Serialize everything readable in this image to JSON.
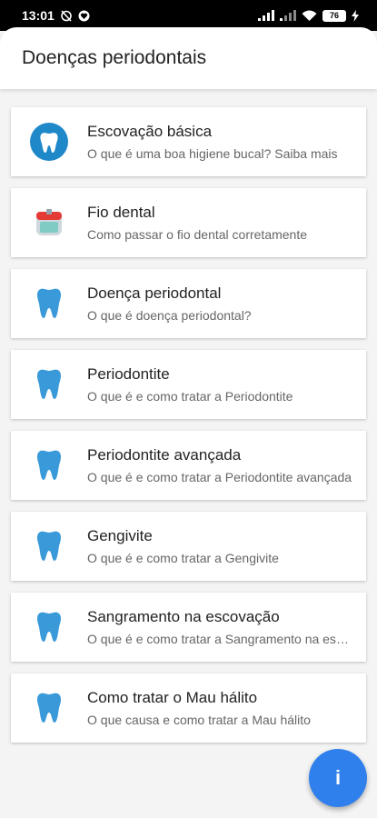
{
  "status_bar": {
    "time": "13:01",
    "battery": "76"
  },
  "app_bar": {
    "title": "Doenças periodontais"
  },
  "items": [
    {
      "title": "Escovação básica",
      "subtitle": "O que é uma boa higiene bucal? Saiba mais",
      "icon": "tooth-circle-icon"
    },
    {
      "title": "Fio dental",
      "subtitle": "Como passar o fio dental corretamente",
      "icon": "floss-icon"
    },
    {
      "title": "Doença periodontal",
      "subtitle": "O que é doença periodontal?",
      "icon": "tooth-icon"
    },
    {
      "title": "Periodontite",
      "subtitle": "O que é e como tratar a Periodontite",
      "icon": "tooth-icon"
    },
    {
      "title": "Periodontite avançada",
      "subtitle": "O que é e como tratar a Periodontite avançada",
      "icon": "tooth-icon"
    },
    {
      "title": "Gengivite",
      "subtitle": "O que é e como tratar a Gengivite",
      "icon": "tooth-icon"
    },
    {
      "title": "Sangramento na escovação",
      "subtitle": "O que é e como tratar a Sangramento na escovação",
      "icon": "tooth-icon"
    },
    {
      "title": "Como tratar o Mau hálito",
      "subtitle": "O que causa e como tratar a Mau hálito",
      "icon": "tooth-icon"
    }
  ],
  "fab": {
    "label": "i",
    "icon": "info-icon"
  },
  "colors": {
    "accent": "#2f80ed",
    "tooth": "#3a9ad9"
  }
}
